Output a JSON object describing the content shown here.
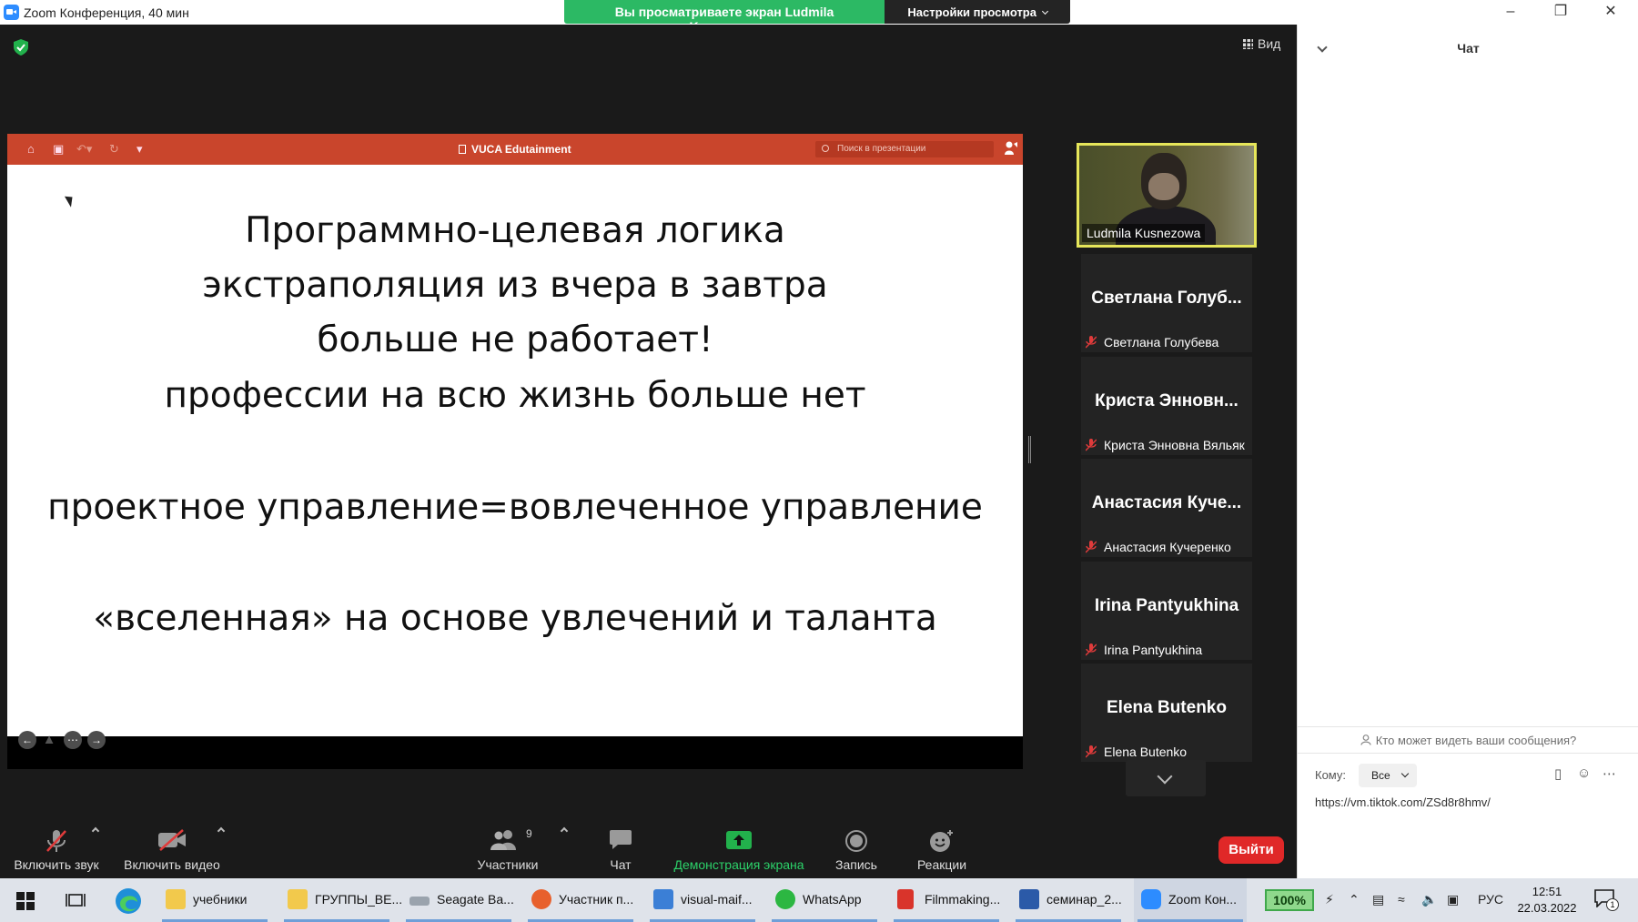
{
  "window": {
    "title": "Zoom Конференция, 40 мин",
    "share_banner": "Вы просматриваете экран Ludmila Kusnezowa",
    "view_settings": "Настройки просмотра",
    "view_button": "Вид"
  },
  "presentation": {
    "title": "VUCA Edutainment",
    "search_placeholder": "Поиск в презентации",
    "lines": [
      "Программно-целевая логика",
      "экстраполяция из вчера в завтра",
      "больше не работает!",
      "профессии на всю жизнь больше нет",
      "проектное управление=вовлеченное управление",
      "«вселенная» на основе увлечений и таланта"
    ]
  },
  "gallery": {
    "active_speaker": "Ludmila Kusnezowa",
    "participants": [
      {
        "display": "Светлана Голуб...",
        "name": "Светлана Голубева"
      },
      {
        "display": "Криста Энновн...",
        "name": "Криста Энновна Вяльяк"
      },
      {
        "display": "Анастасия Куче...",
        "name": "Анастасия Кучеренко"
      },
      {
        "display": "Irina Pantyukhina",
        "name": "Irina Pantyukhina"
      },
      {
        "display": "Elena Butenko",
        "name": "Elena Butenko"
      }
    ]
  },
  "toolbar": {
    "audio": "Включить звук",
    "video": "Включить видео",
    "participants": "Участники",
    "participants_count": "9",
    "chat": "Чат",
    "share": "Демонстрация экрана",
    "record": "Запись",
    "reactions": "Реакции",
    "leave": "Выйти"
  },
  "chat": {
    "title": "Чат",
    "who_can_see": "Кто может видеть ваши сообщения?",
    "to_label": "Кому:",
    "to_value": "Все",
    "input_text": "https://vm.tiktok.com/ZSd8r8hmv/"
  },
  "taskbar": {
    "apps": [
      {
        "label": "учебники",
        "icon": "folder-icon",
        "color": "#f2c94c"
      },
      {
        "label": "ГРУППЫ_ВЕ...",
        "icon": "folder-icon",
        "color": "#f2c94c"
      },
      {
        "label": "Seagate Ba...",
        "icon": "drive-icon",
        "color": "#9aa3ad"
      },
      {
        "label": "Участник п...",
        "icon": "firefox-icon",
        "color": "#e8602c"
      },
      {
        "label": "visual-maif...",
        "icon": "image-icon",
        "color": "#3b7fd6"
      },
      {
        "label": "WhatsApp",
        "icon": "whatsapp-icon",
        "color": "#2cb742"
      },
      {
        "label": "Filmmaking...",
        "icon": "pdf-icon",
        "color": "#d9342b"
      },
      {
        "label": "семинар_2...",
        "icon": "word-icon",
        "color": "#2b5aa8"
      },
      {
        "label": "Zoom Кон...",
        "icon": "zoom-icon",
        "color": "#2d8cff"
      }
    ],
    "battery": "100%",
    "language": "РУС",
    "time": "12:51",
    "date": "22.03.2022",
    "notifications": "1"
  }
}
